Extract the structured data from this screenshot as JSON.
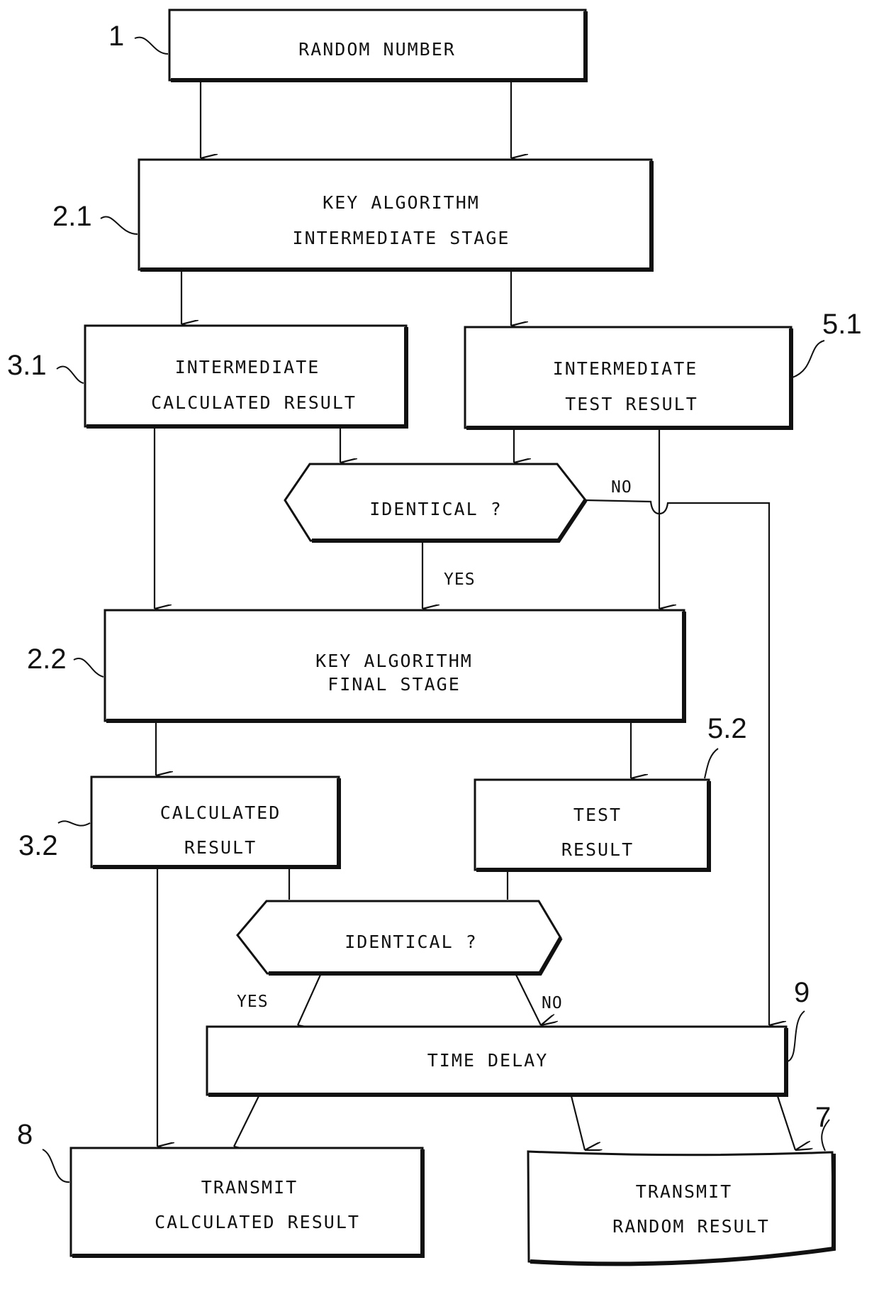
{
  "figure": {
    "nodes": [
      {
        "id": "random-number",
        "ref": "1",
        "lines": [
          "RANDOM NUMBER"
        ],
        "shape": "box"
      },
      {
        "id": "key-algorithm-intermediate",
        "ref": "2.1",
        "lines": [
          "KEY ALGORITHM",
          "INTERMEDIATE STAGE"
        ],
        "shape": "box"
      },
      {
        "id": "intermediate-calculated-result",
        "ref": "3.1",
        "lines": [
          "INTERMEDIATE",
          "CALCULATED RESULT"
        ],
        "shape": "box"
      },
      {
        "id": "intermediate-test-result",
        "ref": "5.1",
        "lines": [
          "INTERMEDIATE",
          "TEST RESULT"
        ],
        "shape": "box"
      },
      {
        "id": "identical-check-1",
        "ref": "",
        "lines": [
          "IDENTICAL ?"
        ],
        "shape": "hexagon"
      },
      {
        "id": "key-algorithm-final",
        "ref": "2.2",
        "lines": [
          "KEY ALGORITHM",
          "FINAL STAGE"
        ],
        "shape": "box"
      },
      {
        "id": "calculated-result",
        "ref": "3.2",
        "lines": [
          "CALCULATED",
          "RESULT"
        ],
        "shape": "box"
      },
      {
        "id": "test-result",
        "ref": "5.2",
        "lines": [
          "TEST",
          "RESULT"
        ],
        "shape": "box"
      },
      {
        "id": "identical-check-2",
        "ref": "",
        "lines": [
          "IDENTICAL ?"
        ],
        "shape": "hexagon"
      },
      {
        "id": "time-delay",
        "ref": "9",
        "lines": [
          "TIME DELAY"
        ],
        "shape": "box"
      },
      {
        "id": "transmit-calculated-result",
        "ref": "8",
        "lines": [
          "TRANSMIT",
          "CALCULATED RESULT"
        ],
        "shape": "box"
      },
      {
        "id": "transmit-random-result",
        "ref": "7",
        "lines": [
          "TRANSMIT",
          "RANDOM RESULT"
        ],
        "shape": "box"
      }
    ],
    "branch_labels": {
      "check1_no": "NO",
      "check1_yes": "YES",
      "check2_yes": "YES",
      "check2_no": "NO"
    },
    "edges": [
      {
        "from": "random-number",
        "to": "key-algorithm-intermediate",
        "count": 2
      },
      {
        "from": "key-algorithm-intermediate",
        "to": "intermediate-calculated-result"
      },
      {
        "from": "key-algorithm-intermediate",
        "to": "intermediate-test-result"
      },
      {
        "from": "intermediate-calculated-result",
        "to": "identical-check-1"
      },
      {
        "from": "intermediate-test-result",
        "to": "identical-check-1"
      },
      {
        "from": "intermediate-calculated-result",
        "to": "key-algorithm-final"
      },
      {
        "from": "intermediate-test-result",
        "to": "key-algorithm-final"
      },
      {
        "from": "identical-check-1",
        "to": "key-algorithm-final",
        "label": "YES"
      },
      {
        "from": "identical-check-1",
        "to": "time-delay",
        "label": "NO"
      },
      {
        "from": "key-algorithm-final",
        "to": "calculated-result"
      },
      {
        "from": "key-algorithm-final",
        "to": "test-result"
      },
      {
        "from": "calculated-result",
        "to": "identical-check-2"
      },
      {
        "from": "test-result",
        "to": "identical-check-2"
      },
      {
        "from": "identical-check-2",
        "to": "time-delay",
        "label": "YES"
      },
      {
        "from": "identical-check-2",
        "to": "time-delay",
        "label": "NO"
      },
      {
        "from": "calculated-result",
        "to": "transmit-calculated-result"
      },
      {
        "from": "time-delay",
        "to": "transmit-calculated-result"
      },
      {
        "from": "time-delay",
        "to": "transmit-random-result",
        "count": 2
      }
    ]
  }
}
